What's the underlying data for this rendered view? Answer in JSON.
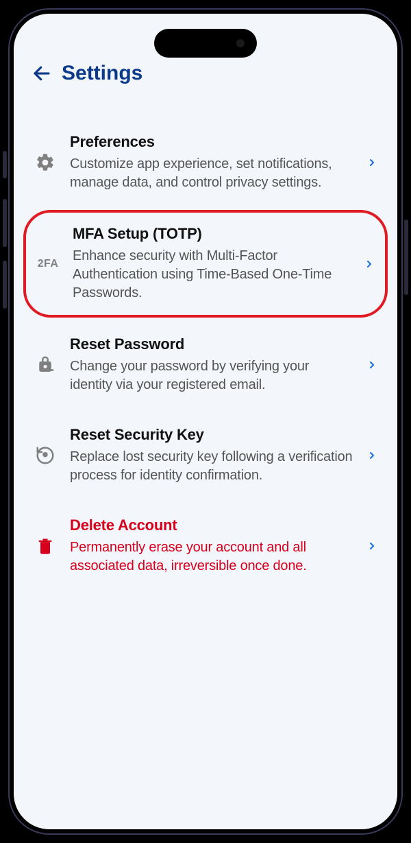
{
  "header": {
    "title": "Settings"
  },
  "items": [
    {
      "icon": "gear-icon",
      "title": "Preferences",
      "desc": "Customize app experience, set notifications, manage data, and control privacy settings.",
      "danger": false,
      "highlight": false
    },
    {
      "icon": "twofa-icon",
      "title": "MFA Setup (TOTP)",
      "desc": "Enhance security with Multi-Factor Authentication using Time-Based One-Time Passwords.",
      "danger": false,
      "highlight": true
    },
    {
      "icon": "lock-reset-icon",
      "title": "Reset Password",
      "desc": "Change your password by verifying your identity via your registered email.",
      "danger": false,
      "highlight": false
    },
    {
      "icon": "key-reset-icon",
      "title": "Reset Security Key",
      "desc": "Replace lost security key following a verification process for identity confirmation.",
      "danger": false,
      "highlight": false
    },
    {
      "icon": "trash-icon",
      "title": "Delete Account",
      "desc": "Permanently erase your account and all associated data, irreversible once done.",
      "danger": true,
      "highlight": false
    }
  ],
  "twofa_label": "2FA"
}
